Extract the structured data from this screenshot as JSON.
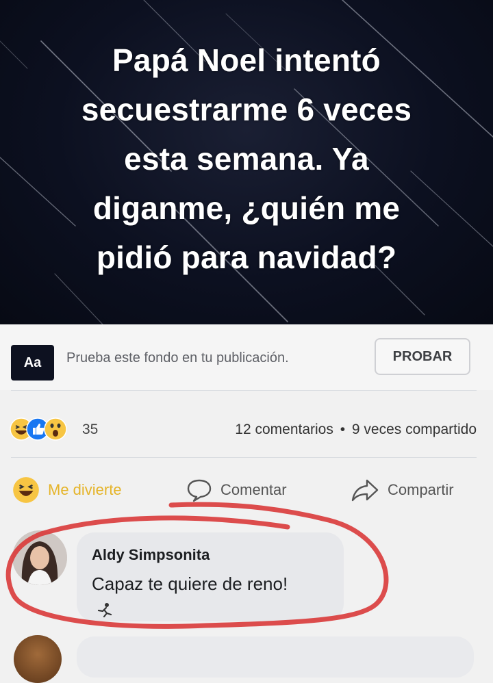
{
  "post": {
    "background_text": "Papá Noel intentó secuestrarme 6 veces esta semana. Ya diganme, ¿quién me pidió para navidad?",
    "lines": [
      "Papá Noel intentó",
      "secuestrarme 6 veces",
      "esta semana. Ya",
      "diganme, ¿quién me",
      "pidió para navidad?"
    ]
  },
  "try_background": {
    "thumb_label": "Aa",
    "prompt": "Prueba este fondo en tu publicación.",
    "button_label": "PROBAR"
  },
  "stats": {
    "reaction_icons": [
      "haha-icon",
      "like-icon",
      "wow-icon"
    ],
    "reaction_count": "35",
    "comments": "12 comentarios",
    "separator": "•",
    "shares": "9 veces compartido"
  },
  "actions": {
    "reaction_label": "Me divierte",
    "comment_label": "Comentar",
    "share_label": "Compartir"
  },
  "comment": {
    "author": "Aldy Simpsonita",
    "text": "Capaz te quiere de reno!"
  },
  "colors": {
    "banner_bg": "#0c1020",
    "haha_yellow": "#f7c543",
    "like_blue": "#1877f2",
    "circle_red": "#d93a3a"
  }
}
